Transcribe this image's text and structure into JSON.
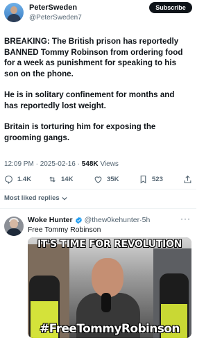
{
  "post": {
    "author_name": "PeterSweden",
    "author_handle": "@PeterSweden7",
    "subscribe_label": "Subscribe",
    "paragraphs": [
      "BREAKING: The British prison has reportedly BANNED Tommy Robinson from ordering food for a week as punishment for speaking to his son on the phone.",
      "He is in solitary confinement for months and has reportedly lost weight.",
      "Britain is torturing him for exposing the grooming gangs."
    ],
    "time": "12:09 PM",
    "date": "2025-02-16",
    "views_count": "548K",
    "views_label": "Views",
    "replies": "1.4K",
    "reposts": "14K",
    "likes": "35K",
    "bookmarks": "523"
  },
  "replies_sort_label": "Most liked replies",
  "reply": {
    "author_name": "Woke Hunter",
    "author_handle": "@thew0kehunter",
    "time": "5h",
    "more_label": "···",
    "text": "Free Tommy Robinson",
    "image_caption_top": "IT'S TIME FOR REVOLUTION",
    "image_caption_bottom": "#FreeTommyRobinson"
  },
  "colors": {
    "text_primary": "#0f1419",
    "text_secondary": "#536471",
    "verified_blue": "#1d9bf0",
    "divider": "#eff3f4"
  },
  "icons": [
    "reply-icon",
    "repost-icon",
    "like-icon",
    "bookmark-icon",
    "share-icon",
    "chevron-down-icon",
    "verified-icon",
    "more-icon"
  ]
}
